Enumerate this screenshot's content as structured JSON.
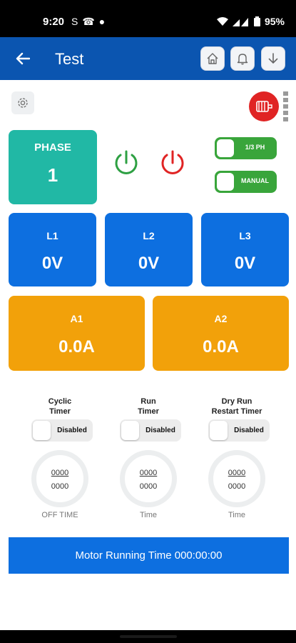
{
  "status_bar": {
    "time": "9:20",
    "icons_left": [
      "S",
      "☎",
      "●"
    ],
    "battery": "95%"
  },
  "app_bar": {
    "title": "Test",
    "icons": [
      "back-arrow-icon",
      "home-icon",
      "bell-icon",
      "download-icon"
    ]
  },
  "phase": {
    "label": "PHASE",
    "value": "1"
  },
  "toggles": {
    "phase_mode": "1/3 PH",
    "control_mode": "MANUAL"
  },
  "colors": {
    "app_bar": "#0b55b0",
    "phase_tile": "#21b8a5",
    "voltage_tile": "#0d6fe0",
    "amp_tile": "#f2a10a",
    "power_on": "#2ea043",
    "power_off": "#e02424",
    "toggle_on": "#39a53b"
  },
  "voltages": [
    {
      "label": "L1",
      "value": "0V"
    },
    {
      "label": "L2",
      "value": "0V"
    },
    {
      "label": "L3",
      "value": "0V"
    }
  ],
  "currents": [
    {
      "label": "A1",
      "value": "0.0A"
    },
    {
      "label": "A2",
      "value": "0.0A"
    }
  ],
  "timers": [
    {
      "title_line1": "Cyclic",
      "title_line2": "Timer",
      "state": "Disabled",
      "top": "0000",
      "bottom": "0000",
      "caption": "OFF TIME"
    },
    {
      "title_line1": "Run",
      "title_line2": "Timer",
      "state": "Disabled",
      "top": "0000",
      "bottom": "0000",
      "caption": "Time"
    },
    {
      "title_line1": "Dry Run",
      "title_line2": "Restart Timer",
      "state": "Disabled",
      "top": "0000",
      "bottom": "0000",
      "caption": "Time"
    }
  ],
  "motor_running": "Motor Running Time 000:00:00"
}
